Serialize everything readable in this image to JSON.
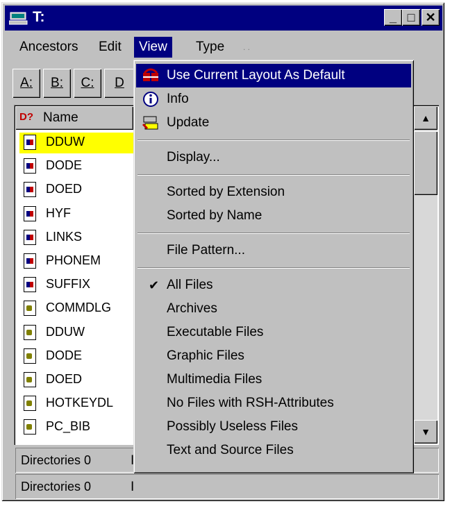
{
  "window": {
    "title": "T:",
    "icon": "computer-icon",
    "controls": {
      "minimize": "_",
      "maximize": "□",
      "close": "✕"
    }
  },
  "menubar": {
    "items": [
      {
        "label": "Ancestors",
        "mnemonic": "A"
      },
      {
        "label": "Edit",
        "mnemonic": "E"
      },
      {
        "label": "View",
        "mnemonic": "V",
        "active": true
      },
      {
        "label": "Type",
        "mnemonic": "T"
      },
      {
        "label": ". .",
        "dim": true
      }
    ]
  },
  "drives": [
    "A:",
    "B:",
    "C:",
    "D"
  ],
  "list": {
    "header": {
      "label": "Name",
      "icon": "sort-question-icon"
    },
    "rows": [
      {
        "name": "DDUW",
        "kind": "exe",
        "selected": true
      },
      {
        "name": "DODE",
        "kind": "exe"
      },
      {
        "name": "DOED",
        "kind": "exe"
      },
      {
        "name": "HYF",
        "kind": "exe"
      },
      {
        "name": "LINKS",
        "kind": "exe"
      },
      {
        "name": "PHONEM",
        "kind": "exe"
      },
      {
        "name": "SUFFIX",
        "kind": "exe"
      },
      {
        "name": "COMMDLG",
        "kind": "doc"
      },
      {
        "name": "DDUW",
        "kind": "doc"
      },
      {
        "name": "DODE",
        "kind": "doc"
      },
      {
        "name": "DOED",
        "kind": "doc"
      },
      {
        "name": "HOTKEYDL",
        "kind": "doc"
      },
      {
        "name": "PC_BIB",
        "kind": "doc"
      }
    ]
  },
  "status": {
    "line1": "Directories 0",
    "line2": "Directories 0",
    "line1_sep": "I",
    "line2_sep": "I"
  },
  "view_menu": {
    "items": [
      {
        "label": "Use Current Layout As Default",
        "icon": "layout-default-icon",
        "highlighted": true
      },
      {
        "label": "Info",
        "icon": "info-icon"
      },
      {
        "label": "Update",
        "icon": "update-icon"
      },
      {
        "label": "Display...",
        "separator_before": true
      },
      {
        "label": "Sorted by Extension",
        "separator_before": true
      },
      {
        "label": "Sorted by Name"
      },
      {
        "label": "File Pattern...",
        "separator_before": true
      },
      {
        "label": "All Files",
        "checked": true,
        "separator_before": true
      },
      {
        "label": "Archives"
      },
      {
        "label": "Executable Files"
      },
      {
        "label": "Graphic Files"
      },
      {
        "label": "Multimedia Files"
      },
      {
        "label": "No Files with RSH-Attributes"
      },
      {
        "label": "Possibly Useless Files"
      },
      {
        "label": "Text and Source Files"
      }
    ]
  },
  "colors": {
    "titlebar": "#000080",
    "highlight": "#000080",
    "selected_row": "#ffff00",
    "face": "#c0c0c0"
  }
}
